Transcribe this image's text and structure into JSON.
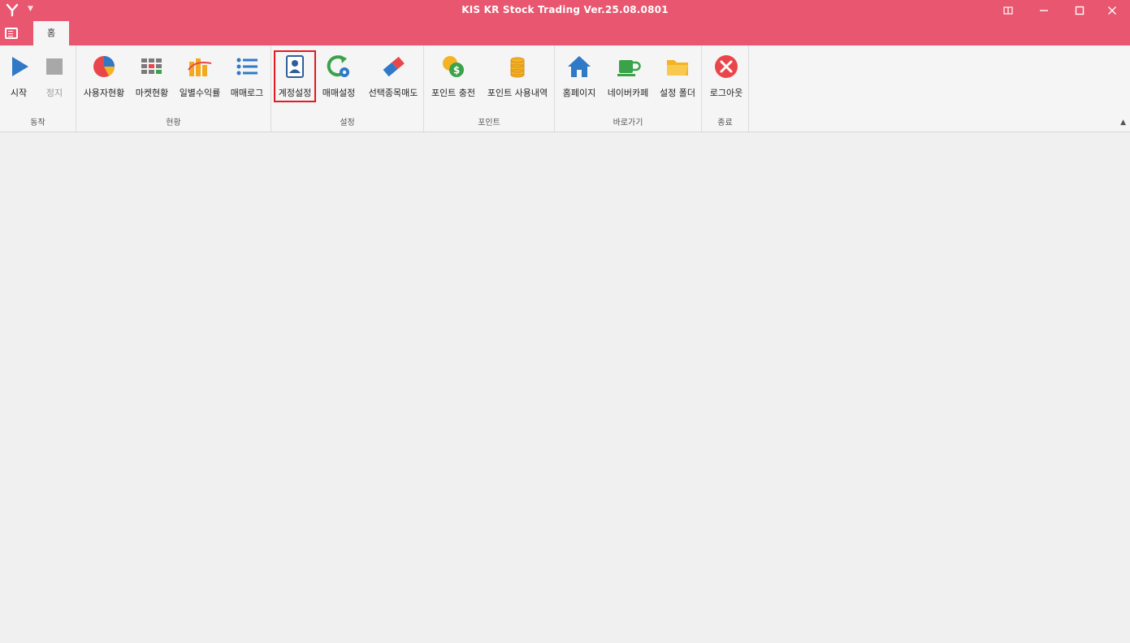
{
  "titlebar": {
    "title": "KIS KR Stock Trading Ver.25.08.0801",
    "controls": [
      "restore-icon",
      "minimize-icon",
      "maximize-icon",
      "close-icon"
    ]
  },
  "tabs": {
    "active": "홈"
  },
  "ribbon": {
    "groups": [
      {
        "label": "동작",
        "buttons": [
          {
            "label": "시작",
            "icon": "play-icon"
          },
          {
            "label": "정지",
            "icon": "stop-icon",
            "disabled": true
          }
        ]
      },
      {
        "label": "현황",
        "buttons": [
          {
            "label": "사용자현황",
            "icon": "pie-chart-icon"
          },
          {
            "label": "마켓현황",
            "icon": "grid-icon"
          },
          {
            "label": "일별수익률",
            "icon": "bar-chart-icon"
          },
          {
            "label": "매매로그",
            "icon": "list-icon"
          }
        ]
      },
      {
        "label": "설정",
        "buttons": [
          {
            "label": "계정설정",
            "icon": "account-icon",
            "selected": true
          },
          {
            "label": "매매설정",
            "icon": "refresh-gear-icon"
          },
          {
            "label": "선택종목매도",
            "icon": "eraser-icon"
          }
        ]
      },
      {
        "label": "포인트",
        "buttons": [
          {
            "label": "포인트 충전",
            "icon": "coins-dollar-icon"
          },
          {
            "label": "포인트 사용내역",
            "icon": "coin-stack-icon"
          }
        ]
      },
      {
        "label": "바로가기",
        "buttons": [
          {
            "label": "홈페이지",
            "icon": "home-icon"
          },
          {
            "label": "네이버카페",
            "icon": "cup-icon"
          },
          {
            "label": "설정 폴더",
            "icon": "folder-icon"
          }
        ]
      },
      {
        "label": "종료",
        "buttons": [
          {
            "label": "로그아웃",
            "icon": "logout-icon"
          }
        ]
      }
    ]
  },
  "colors": {
    "brand": "#e9566f",
    "ribbon_bg": "#f5f5f5",
    "selection_outline": "#e21b24"
  }
}
